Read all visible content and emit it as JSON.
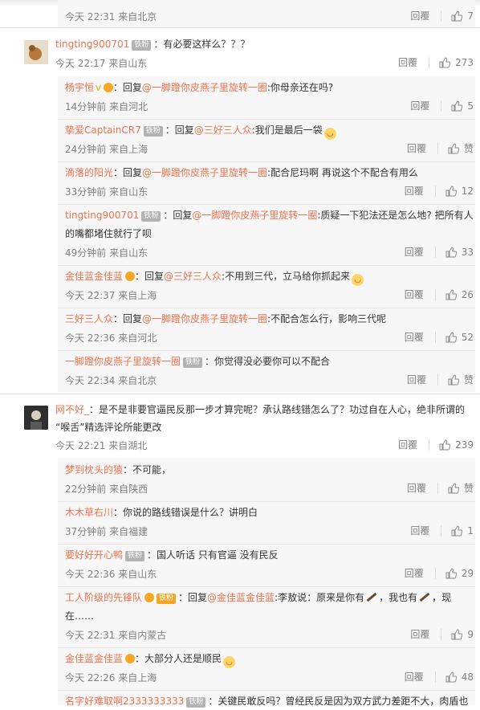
{
  "actions": {
    "reply": "回覆"
  },
  "top_item": {
    "meta": "今天 22:31 来自北京",
    "likes": "7"
  },
  "main1": {
    "user": "tingting900701",
    "badge": "铁粉",
    "text": "：有必要这样么？？？",
    "meta": "今天 22:17 来自山东",
    "likes": "273",
    "replies": [
      {
        "user": "杨宇恒",
        "pre": "：回复",
        "mention": "@一脚蹬你皮燕子里旋转一圈",
        "text": ":你母亲还在吗?",
        "meta": "14分钟前 来自河北",
        "likes": "5"
      },
      {
        "user": "挚爱CaptainCR7",
        "badge": "铁粉",
        "pre": "：回复",
        "mention": "@三好三人众",
        "text": ":我们是最后一袋",
        "meta": "24分钟前 来自上海",
        "likes": "赞"
      },
      {
        "user": "滴落的阳光",
        "pre": "：回复",
        "mention": "@一脚蹬你皮燕子里旋转一圈",
        "text": ":配合尼玛啊 再说这个不配合有用么",
        "meta": "33分钟前 来自山东",
        "likes": "12"
      },
      {
        "user": "tingting900701",
        "badge": "铁粉",
        "pre": "：回复",
        "mention": "@一脚蹬你皮燕子里旋转一圈",
        "text": ":质疑一下犯法还是怎么地? 把所有人",
        "text2": "的嘴都堵住就行了呗",
        "meta": "49分钟前 来自山东",
        "likes": "33"
      },
      {
        "user": "金佳蓝金佳蓝",
        "pre": "：回复",
        "mention": "@三好三人众",
        "text": ":不用到三代，立马给你抓起来",
        "meta": "今天 22:37 来自上海",
        "likes": "26"
      },
      {
        "user": "三好三人众",
        "pre": "：回复",
        "mention": "@一脚蹬你皮燕子里旋转一圈",
        "text": ":不配合怎么行，影响三代呢",
        "meta": "今天 22:36 来自河北",
        "likes": "52"
      },
      {
        "user": "一脚蹬你皮燕子里旋转一圈",
        "badge": "铁粉",
        "text": "：你觉得没必要你可以不配合",
        "meta": "今天 22:34 来自北京",
        "likes": "赞"
      }
    ]
  },
  "main2": {
    "user": "网不好_",
    "text": "：是不是非要官逼民反那一步才算完呢？承认路线错怎么了？功过自在人心，绝非所谓的",
    "text2": "“喉舌”精选评论所能更改",
    "meta": "今天 22:21 来自湖北",
    "likes": "239",
    "replies": [
      {
        "user": "梦到枕头的猿",
        "text": "：不可能，",
        "meta": "22分钟前 来自陕西",
        "likes": "赞"
      },
      {
        "user": "木木草右川",
        "text": "：你说的路线错误是什么？讲明白",
        "meta": "37分钟前 来自福建",
        "likes": "1"
      },
      {
        "user": "要好好开心鸭",
        "badge": "铁粉",
        "text": "：国人听话 只有官逼 没有民反",
        "meta": "今天 22:36 来自山东",
        "likes": "29"
      },
      {
        "user": "工人阶级的先锋队",
        "pre": "：回复",
        "mention": "@金佳蓝金佳蓝",
        "text": ":李敖说：原来是你有",
        "text_b": "，我也有",
        "text_c": "，现",
        "text2": "在……",
        "meta": "今天 22:31 来自内蒙古",
        "likes": "9"
      },
      {
        "user": "金佳蓝金佳蓝",
        "text": "：大部分人还是顺民",
        "meta": "今天 22:26 来自上海",
        "likes": "48"
      },
      {
        "user": "名字好难取啊2333333333",
        "badge": "铁粉",
        "text": "：关键民敢反吗？曾经民反是因为双方武力差距不大，肉盾也"
      }
    ]
  },
  "colors": {
    "name": "#eb7350",
    "meta": "#808080",
    "text": "#333333",
    "badge": "#b3b3b3",
    "reply_bg": "#f7f7f7"
  }
}
